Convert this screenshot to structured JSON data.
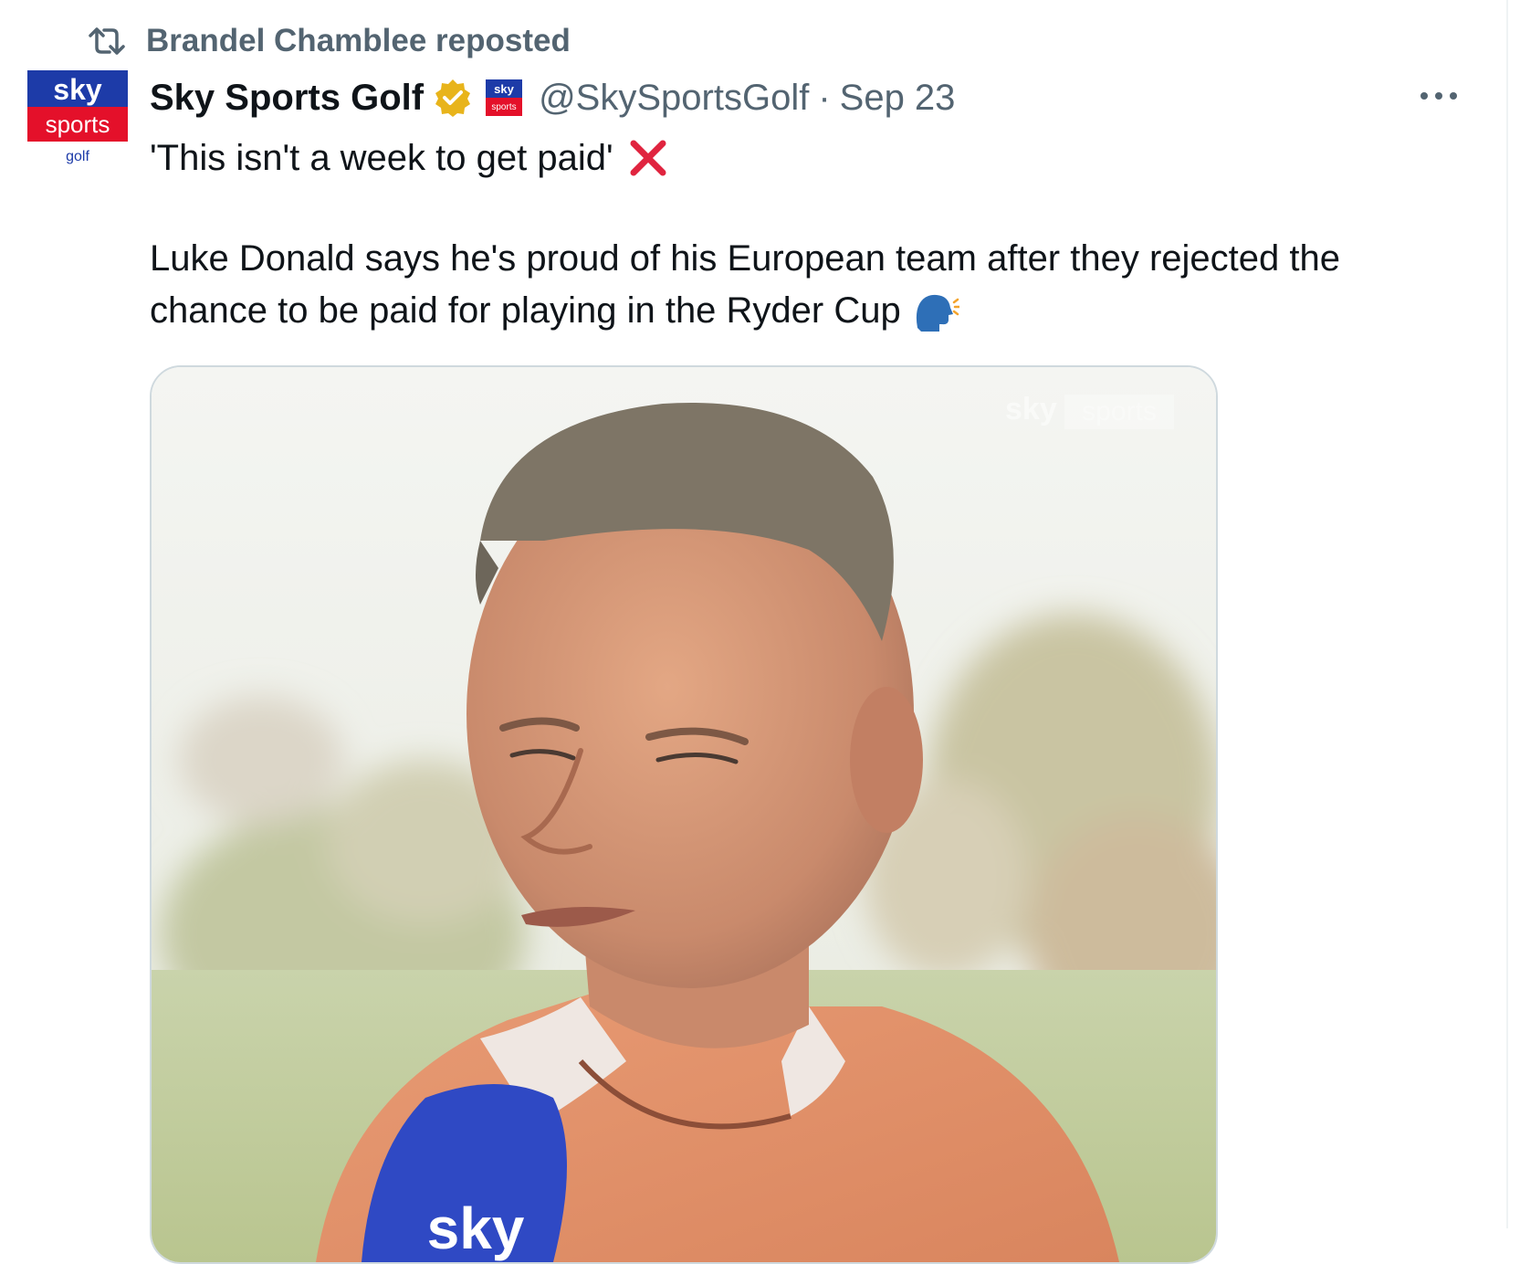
{
  "repost": {
    "text": "Brandel Chamblee reposted",
    "icon": "repost-icon"
  },
  "author": {
    "avatar_lines": [
      "sky",
      "sports",
      "golf"
    ],
    "name": "Sky Sports Golf",
    "verified_icon": "verified-badge-icon",
    "affiliate_badge_lines": [
      "sky",
      "sports"
    ],
    "handle": "@SkySportsGolf",
    "separator": "·",
    "date": "Sep 23"
  },
  "tweet": {
    "line1": "'This isn't a week to get paid'",
    "line1_emoji": "x-mark-icon",
    "body": "Luke Donald says he's proud of his European team after they rejected the chance to be paid for playing in the Ryder Cup",
    "body_emoji": "speaking-head-icon"
  },
  "media": {
    "type": "video-still",
    "subject": "man being interviewed outdoors, holding a microphone",
    "watermark": [
      "sky",
      "sports"
    ],
    "mic_logo": "sky"
  },
  "colors": {
    "sky_blue": "#1d3ba8",
    "sky_red": "#e4102a",
    "text_primary": "#0f1419",
    "text_secondary": "#536471",
    "verified_gold": "#e8b41b",
    "x_red": "#e0243f",
    "border": "#cfd9de"
  }
}
